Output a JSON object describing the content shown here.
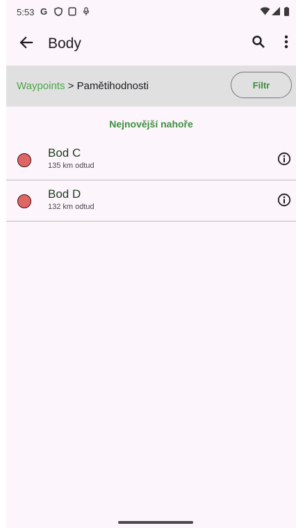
{
  "status_bar": {
    "time": "5:53",
    "icons": [
      "google-g-icon",
      "shield-icon",
      "screenshot-icon",
      "microphone-icon",
      "wifi-icon",
      "signal-icon",
      "battery-icon"
    ]
  },
  "app_bar": {
    "title": "Body",
    "back_icon": "arrow-left-icon",
    "search_icon": "search-icon",
    "more_icon": "more-vert-icon"
  },
  "breadcrumb": {
    "root": "Waypoints",
    "separator": " > ",
    "current": "Pamětihodnosti"
  },
  "filter_button": {
    "label": "Filtr"
  },
  "sort_label": "Nejnovější nahoře",
  "waypoints": [
    {
      "name": "Bod C",
      "distance": "135 km odtud",
      "color": "#e06666",
      "info_icon": "info-icon"
    },
    {
      "name": "Bod D",
      "distance": "132 km odtud",
      "color": "#e06666",
      "info_icon": "info-icon"
    }
  ],
  "colors": {
    "background": "#fcf5fb",
    "accent_green": "#4ca64c",
    "crumb_bar": "#e0e0e0",
    "marker": "#e06666"
  }
}
